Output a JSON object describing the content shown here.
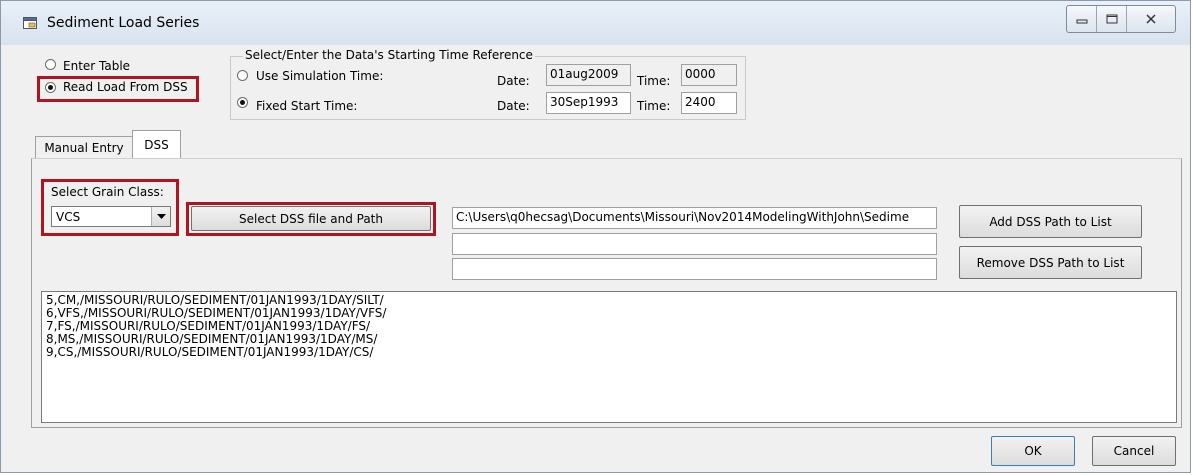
{
  "window": {
    "title": "Sediment Load Series"
  },
  "data_source": {
    "enter_table_label": "Enter Table",
    "read_dss_label": "Read Load From DSS",
    "selected": "read_dss"
  },
  "time_reference": {
    "group_title": "Select/Enter the Data's Starting Time Reference",
    "simulation_label": "Use Simulation Time:",
    "fixed_label": "Fixed Start Time:",
    "date_label": "Date:",
    "time_label": "Time:",
    "simulation_date": "01aug2009",
    "simulation_time": "0000",
    "fixed_date": "30Sep1993",
    "fixed_time": "2400",
    "selected": "fixed"
  },
  "tabs": [
    {
      "label": "Manual Entry",
      "active": false
    },
    {
      "label": "DSS",
      "active": true
    }
  ],
  "dss": {
    "grain_class_label": "Select Grain Class:",
    "grain_class_value": "VCS",
    "select_file_button": "Select DSS file and Path",
    "path_field_1": "C:\\Users\\q0hecsag\\Documents\\Missouri\\Nov2014ModelingWithJohn\\Sedime",
    "path_field_2": "",
    "path_field_3": "",
    "add_path_button": "Add DSS Path to List",
    "remove_path_button": "Remove DSS Path to List",
    "path_list": [
      "5,CM,/MISSOURI/RULO/SEDIMENT/01JAN1993/1DAY/SILT/",
      "6,VFS,/MISSOURI/RULO/SEDIMENT/01JAN1993/1DAY/VFS/",
      "7,FS,/MISSOURI/RULO/SEDIMENT/01JAN1993/1DAY/FS/",
      "8,MS,/MISSOURI/RULO/SEDIMENT/01JAN1993/1DAY/MS/",
      "9,CS,/MISSOURI/RULO/SEDIMENT/01JAN1993/1DAY/CS/"
    ]
  },
  "footer": {
    "ok_button": "OK",
    "cancel_button": "Cancel"
  },
  "colors": {
    "highlight": "#b0141f",
    "title_bar": "#dfe8f2"
  }
}
